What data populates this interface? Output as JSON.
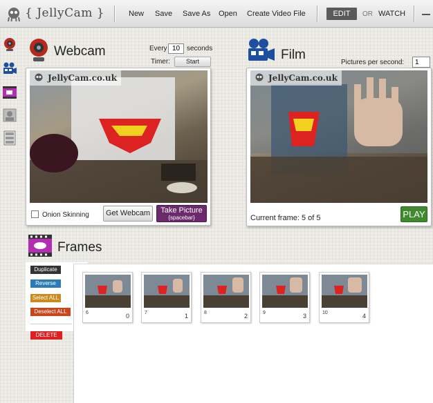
{
  "app": {
    "logo_text": "{ JellyCam }",
    "menu": [
      "New",
      "Save",
      "Save As",
      "Open",
      "Create Video File"
    ],
    "mode_edit": "EDIT",
    "mode_or": "OR",
    "mode_watch": "WATCH"
  },
  "sidebar_icons": [
    "webcam-icon",
    "film-camera-icon",
    "frames-icon",
    "photo-icon",
    "filmstrip-icon"
  ],
  "webcam": {
    "title": "Webcam",
    "every_label": "Every",
    "every_value": "10",
    "seconds_label": "seconds",
    "timer_label": "Timer:",
    "start_button": "Start",
    "watermark": "JellyCam.co.uk",
    "onion_skinning": "Onion Skinning",
    "onion_checked": false,
    "get_webcam": "Get Webcam",
    "take_picture": "Take Picture",
    "take_picture_hint": "{spacebar}"
  },
  "film": {
    "title": "Film",
    "pps_label": "Pictures per second:",
    "pps_value": "1",
    "watermark": "JellyCam.co.uk",
    "current_frame": "Current frame: 5 of 5",
    "play_button": "PLAY"
  },
  "frames": {
    "title": "Frames",
    "actions": [
      {
        "label": "Duplicate",
        "color": "#333333"
      },
      {
        "label": "Reverse",
        "color": "#2c7bb6"
      },
      {
        "label": "Select ALL",
        "color": "#cc8a1e"
      },
      {
        "label": "Deselect ALL",
        "color": "#c9461c"
      },
      {
        "label": "DELETE",
        "color": "#e02020"
      }
    ],
    "items": [
      {
        "id": "6",
        "index": "0"
      },
      {
        "id": "7",
        "index": "1"
      },
      {
        "id": "8",
        "index": "2"
      },
      {
        "id": "9",
        "index": "3"
      },
      {
        "id": "10",
        "index": "4"
      }
    ]
  }
}
